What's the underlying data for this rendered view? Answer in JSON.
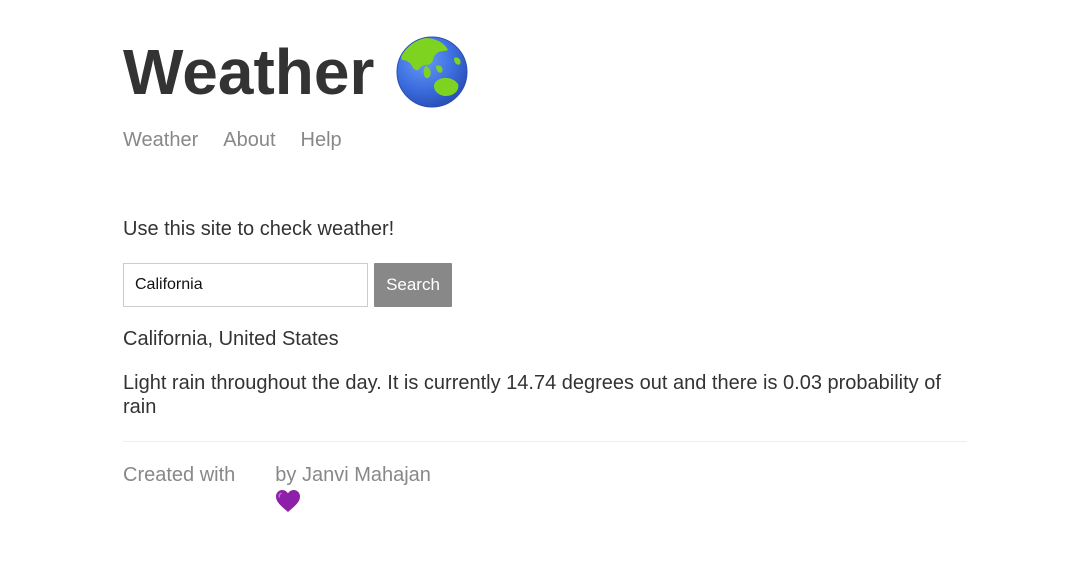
{
  "header": {
    "title": "Weather",
    "title_icon": "globe-asia-australia-icon"
  },
  "nav": {
    "items": [
      {
        "label": "Weather"
      },
      {
        "label": "About"
      },
      {
        "label": "Help"
      }
    ]
  },
  "main": {
    "intro": "Use this site to check weather!",
    "search": {
      "value": "California",
      "placeholder": "Location",
      "button_label": "Search"
    },
    "result": {
      "location": "California, United States",
      "forecast": "Light rain throughout the day. It is currently 14.74 degrees out and there is 0.03 probability of rain"
    }
  },
  "footer": {
    "prefix": "Created with",
    "heart_icon": "purple-heart-icon",
    "suffix": "by Janvi Mahajan"
  },
  "colors": {
    "text": "#333333",
    "muted": "#888888",
    "button_bg": "#888888",
    "heart": "#8e1fa8",
    "globe_ocean": "#3d6fe0",
    "globe_land": "#7ed321"
  }
}
